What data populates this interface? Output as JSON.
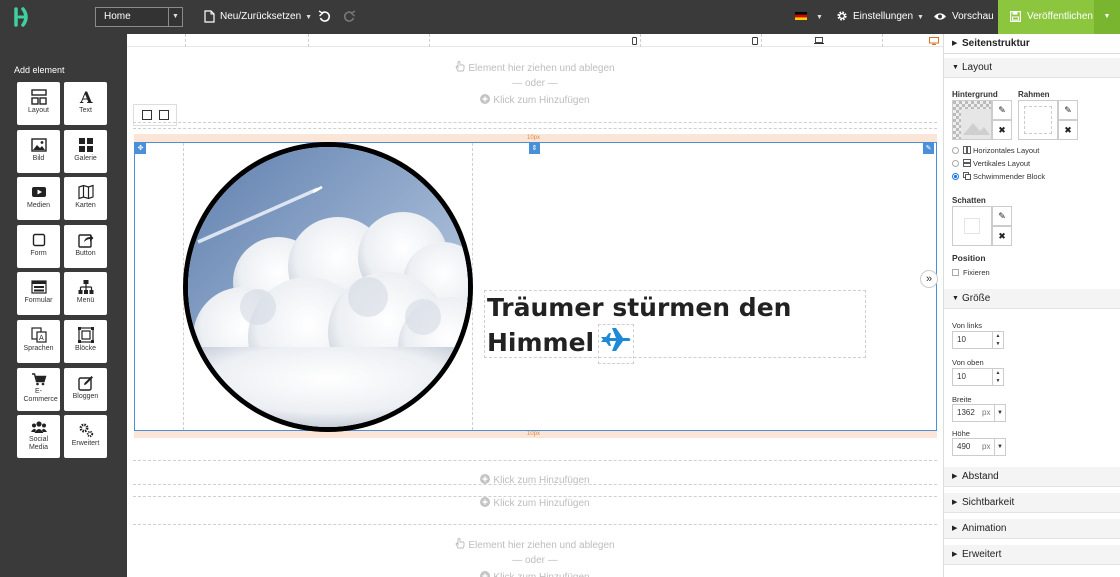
{
  "topbar": {
    "page_select": "Home",
    "new_reset": "Neu/Zurücksetzen",
    "settings": "Einstellungen",
    "preview": "Vorschau",
    "publish": "Veröffentlichen"
  },
  "sidebar": {
    "title": "Add element",
    "items": [
      {
        "label": "Layout",
        "icon": "layout-icon"
      },
      {
        "label": "Text",
        "icon": "text-icon"
      },
      {
        "label": "Bild",
        "icon": "image-icon"
      },
      {
        "label": "Galerie",
        "icon": "gallery-icon"
      },
      {
        "label": "Medien",
        "icon": "media-icon"
      },
      {
        "label": "Karten",
        "icon": "map-icon"
      },
      {
        "label": "Form",
        "icon": "form-icon"
      },
      {
        "label": "Button",
        "icon": "button-icon"
      },
      {
        "label": "Formular",
        "icon": "formular-icon"
      },
      {
        "label": "Menü",
        "icon": "menu-icon"
      },
      {
        "label": "Sprachen",
        "icon": "languages-icon"
      },
      {
        "label": "Blöcke",
        "icon": "blocks-icon"
      },
      {
        "label": "E-Commerce",
        "icon": "cart-icon"
      },
      {
        "label": "Bloggen",
        "icon": "blog-icon"
      },
      {
        "label": "Social Media",
        "icon": "social-icon"
      },
      {
        "label": "Erweitert",
        "icon": "advanced-icon"
      }
    ]
  },
  "canvas": {
    "drop_here": "Element hier ziehen und ablegen",
    "or": "— oder —",
    "click_add": "Klick zum Hinzufügen",
    "spacing_label": "10px",
    "headline_line1": "Träumer stürmen den",
    "headline_line2": "Himmel"
  },
  "panel": {
    "page_structure": "Seitenstruktur",
    "layout": "Layout",
    "background": "Hintergrund",
    "border": "Rahmen",
    "layout_options": [
      "Horizontales Layout",
      "Vertikales Layout",
      "Schwimmender Block"
    ],
    "layout_selected": "Schwimmender Block",
    "shadow": "Schatten",
    "position": "Position",
    "fix": "Fixieren",
    "size": "Größe",
    "from_left": "Von links",
    "from_left_value": "10",
    "from_top": "Von oben",
    "from_top_value": "10",
    "width": "Breite",
    "width_value": "1362",
    "height": "Höhe",
    "height_value": "490",
    "unit": "px",
    "spacing": "Abstand",
    "visibility": "Sichtbarkeit",
    "animation": "Animation",
    "advanced": "Erweitert"
  },
  "colors": {
    "accent_green": "#8cc63f",
    "selection_blue": "#4a90d9",
    "plane_blue": "#1e8ad6"
  }
}
